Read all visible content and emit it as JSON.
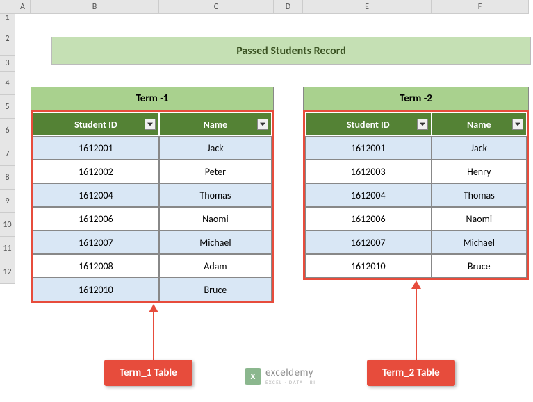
{
  "columns": [
    "A",
    "B",
    "C",
    "D",
    "E",
    "F"
  ],
  "rows": [
    "1",
    "2",
    "3",
    "4",
    "5",
    "6",
    "7",
    "8",
    "9",
    "10",
    "11",
    "12"
  ],
  "title": "Passed Students Record",
  "term1": {
    "label": "Term -1",
    "headers": {
      "id": "Student ID",
      "name": "Name"
    },
    "data": [
      {
        "id": "1612001",
        "name": "Jack"
      },
      {
        "id": "1612002",
        "name": "Peter"
      },
      {
        "id": "1612004",
        "name": "Thomas"
      },
      {
        "id": "1612006",
        "name": "Naomi"
      },
      {
        "id": "1612007",
        "name": "Michael"
      },
      {
        "id": "1612008",
        "name": "Adam"
      },
      {
        "id": "1612010",
        "name": "Bruce"
      }
    ],
    "callout": "Term_1 Table"
  },
  "term2": {
    "label": "Term -2",
    "headers": {
      "id": "Student ID",
      "name": "Name"
    },
    "data": [
      {
        "id": "1612001",
        "name": "Jack"
      },
      {
        "id": "1612003",
        "name": "Henry"
      },
      {
        "id": "1612004",
        "name": "Thomas"
      },
      {
        "id": "1612006",
        "name": "Naomi"
      },
      {
        "id": "1612007",
        "name": "Michael"
      },
      {
        "id": "1612010",
        "name": "Bruce"
      }
    ],
    "callout": "Term_2 Table"
  },
  "watermark": {
    "brand": "exceldemy",
    "tagline": "EXCEL · DATA · BI",
    "logo": "x"
  }
}
